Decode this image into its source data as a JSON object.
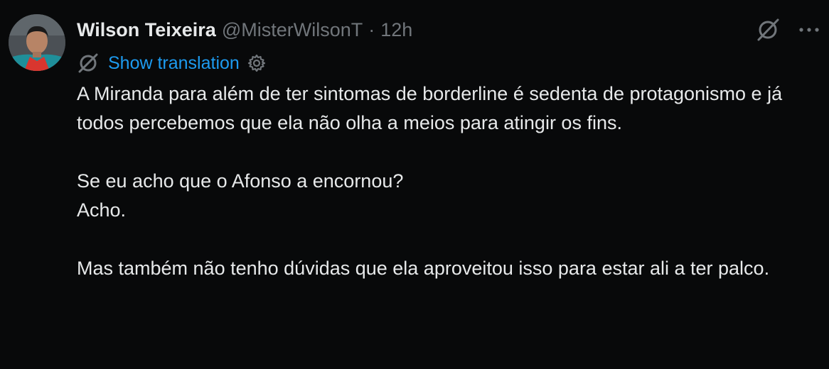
{
  "author": {
    "display_name": "Wilson Teixeira",
    "handle": "@MisterWilsonT",
    "separator": "·",
    "time": "12h",
    "avatar_icon": "avatar-photo"
  },
  "translation": {
    "icon": "translate-globe-icon",
    "label": "Show translation",
    "settings_icon": "gear-icon"
  },
  "actions": {
    "grok_icon": "grok-icon",
    "more_icon": "more-icon"
  },
  "tweet": {
    "paragraphs": [
      "A Miranda para além de ter sintomas de borderline é sedenta de protagonismo e já todos percebemos que ela não olha a meios para atingir os fins.",
      "Se eu acho que o Afonso a encornou?\nAcho.",
      "Mas também não tenho dúvidas que ela aproveitou isso para estar ali a ter palco."
    ]
  },
  "colors": {
    "background": "#08090a",
    "text": "#e7e9ea",
    "secondary": "#71767b",
    "link": "#1d9bf0"
  }
}
